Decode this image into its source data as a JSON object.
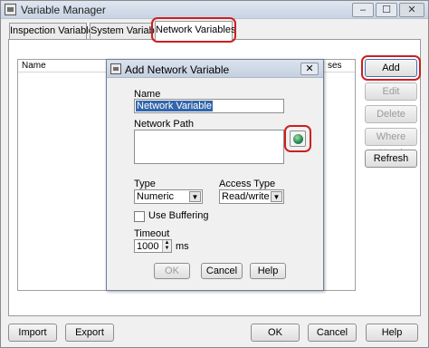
{
  "window": {
    "title": "Variable Manager",
    "min": "–",
    "max": "☐",
    "close": "✕"
  },
  "tabs": [
    {
      "label": "Inspection Variables"
    },
    {
      "label": "System Variables"
    },
    {
      "label": "Network Variables"
    }
  ],
  "list": {
    "columns": [
      "Name",
      "ses"
    ]
  },
  "side_buttons": {
    "add": "Add",
    "edit": "Edit",
    "delete": "Delete",
    "where_used": "Where Used",
    "refresh": "Refresh"
  },
  "bottom_buttons": {
    "import": "Import",
    "export": "Export",
    "ok": "OK",
    "cancel": "Cancel",
    "help": "Help"
  },
  "dialog": {
    "title": "Add Network Variable",
    "close": "✕",
    "name_label": "Name",
    "name_value": "Network Variable",
    "path_label": "Network Path",
    "type_label": "Type",
    "type_value": "Numeric",
    "access_label": "Access Type",
    "access_value": "Read/write",
    "buffer_label": "Use Buffering",
    "timeout_label": "Timeout",
    "timeout_value": "1000",
    "timeout_unit": "ms",
    "ok": "OK",
    "cancel": "Cancel",
    "help": "Help"
  },
  "colors": {
    "highlight": "#cc2020",
    "selection": "#3366aa"
  }
}
